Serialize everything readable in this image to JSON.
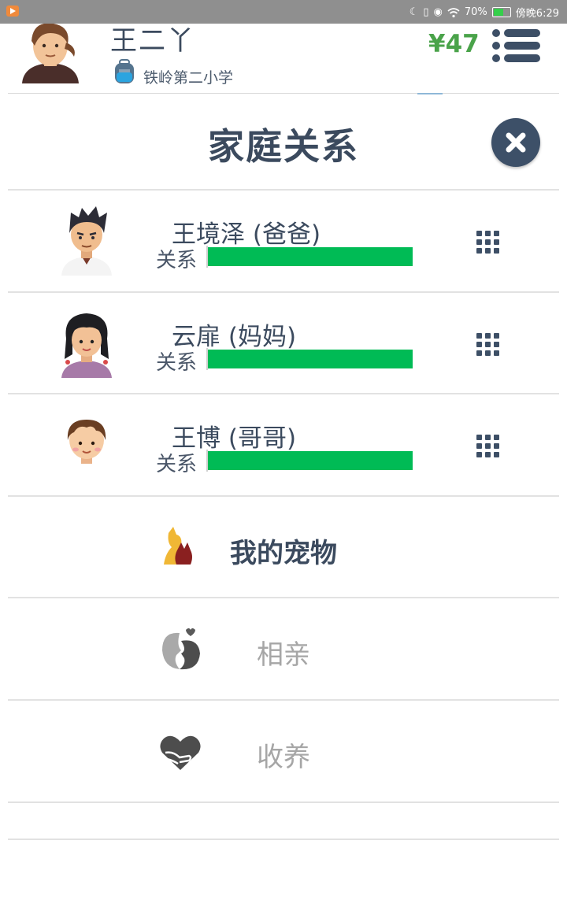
{
  "status_bar": {
    "battery_percent": "70%",
    "battery_level": 0.7,
    "time": "傍晚6:29",
    "icons": [
      "moon-icon",
      "vibrate-icon",
      "eye-icon",
      "wifi-icon",
      "battery-icon"
    ]
  },
  "header": {
    "user_name": "王二丫",
    "school": "铁岭第二小学",
    "balance": "¥47",
    "balance_color": "#4aa34a"
  },
  "dialog": {
    "title": "家庭关系"
  },
  "family": [
    {
      "name": "王境泽 (爸爸)",
      "relation_label": "关系",
      "relation_level": 1.0,
      "avatar": "father-avatar"
    },
    {
      "name": "云扉 (妈妈)",
      "relation_label": "关系",
      "relation_level": 1.0,
      "avatar": "mother-avatar"
    },
    {
      "name": "王博 (哥哥)",
      "relation_label": "关系",
      "relation_level": 1.0,
      "avatar": "brother-avatar"
    }
  ],
  "actions": {
    "pets": "我的宠物",
    "matchmaking": "相亲",
    "adopt": "收养"
  },
  "colors": {
    "relation_bar": "#00bb55",
    "text_dark": "#3b4a5e",
    "disabled_text": "#a6a6a6",
    "close_button": "#3d5068"
  }
}
